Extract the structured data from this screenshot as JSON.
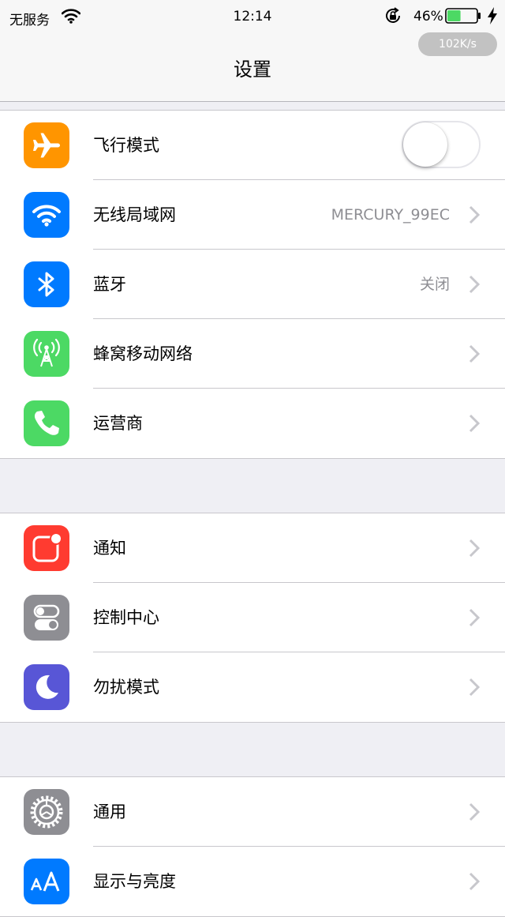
{
  "status_bar": {
    "carrier": "无服务",
    "time": "12:14",
    "battery_percent": "46%",
    "battery_level": 0.46,
    "net_speed": "102K/s"
  },
  "nav": {
    "title": "设置"
  },
  "groups": [
    {
      "rows": [
        {
          "label": "飞行模式",
          "icon": "airplane-icon",
          "icon_color": "#ff9500",
          "toggle_on": false
        },
        {
          "label": "无线局域网",
          "icon": "wifi-icon",
          "icon_color": "#007aff",
          "value": "MERCURY_99EC"
        },
        {
          "label": "蓝牙",
          "icon": "bluetooth-icon",
          "icon_color": "#007aff",
          "value": "关闭"
        },
        {
          "label": "蜂窝移动网络",
          "icon": "cellular-antenna-icon",
          "icon_color": "#4cd964"
        },
        {
          "label": "运营商",
          "icon": "phone-icon",
          "icon_color": "#4cd964"
        }
      ]
    },
    {
      "rows": [
        {
          "label": "通知",
          "icon": "notifications-icon",
          "icon_color": "#ff3b30"
        },
        {
          "label": "控制中心",
          "icon": "control-center-icon",
          "icon_color": "#8e8e93"
        },
        {
          "label": "勿扰模式",
          "icon": "moon-icon",
          "icon_color": "#5856d6"
        }
      ]
    },
    {
      "rows": [
        {
          "label": "通用",
          "icon": "gear-icon",
          "icon_color": "#8e8e93"
        },
        {
          "label": "显示与亮度",
          "icon": "text-size-icon",
          "icon_color": "#007aff"
        }
      ]
    }
  ]
}
